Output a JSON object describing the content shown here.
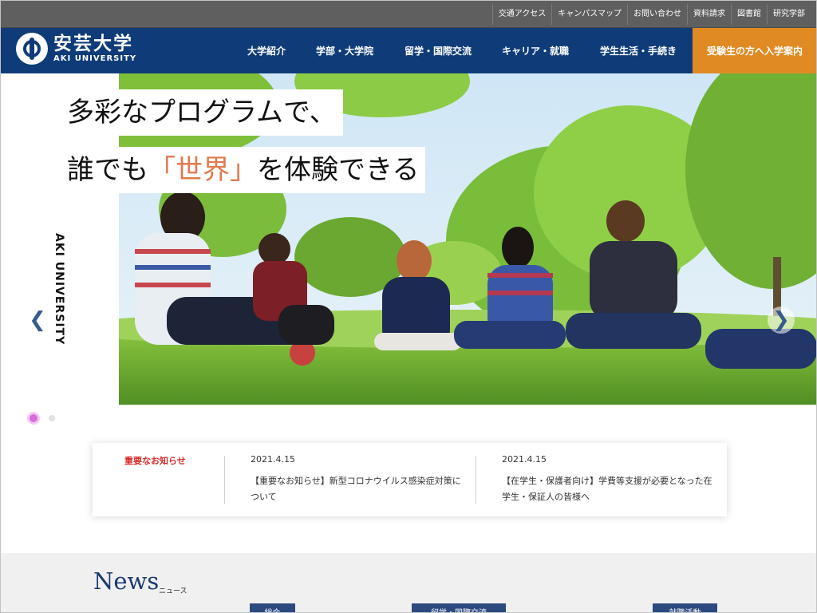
{
  "utility_nav": [
    "交通アクセス",
    "キャンパスマップ",
    "お問い合わせ",
    "資料請求",
    "図書館",
    "研究学部"
  ],
  "logo": {
    "name": "安芸大学",
    "english": "AKI UNIVERSITY"
  },
  "main_nav": [
    "大学紹介",
    "学部・大学院",
    "留学・国際交流",
    "キャリア・就職",
    "学生生活・手続き"
  ],
  "cta": "受験生の方へ入学案内",
  "hero": {
    "line1": "多彩なプログラムで、",
    "line2_prefix": "誰でも",
    "line2_accent": "「世界」",
    "line2_suffix": "を体験できる",
    "side_label": "AKI UNIVERSITY",
    "prev_icon": "chevron-left-icon",
    "next_icon": "chevron-right-icon",
    "slide_total": 2,
    "slide_current": 1
  },
  "notice": {
    "title": "重要なお知らせ",
    "items": [
      {
        "date": "2021.4.15",
        "text": "【重要なお知らせ】新型コロナウイルス感染症対策について"
      },
      {
        "date": "2021.4.15",
        "text": "【在学生・保護者向け】学費等支援が必要となった在学生・保証人の皆様へ"
      }
    ]
  },
  "news": {
    "heading": "News",
    "sub": "ニュース",
    "categories": [
      "総合",
      "留学・国際交流",
      "就職活動"
    ]
  },
  "colors": {
    "header_bg": "#0f3c78",
    "utility_bg": "#5f5f5f",
    "cta_bg": "#e08a24",
    "notice_title": "#d92b2b",
    "headline_accent": "#e07a4e",
    "news_heading": "#1b3a73"
  }
}
